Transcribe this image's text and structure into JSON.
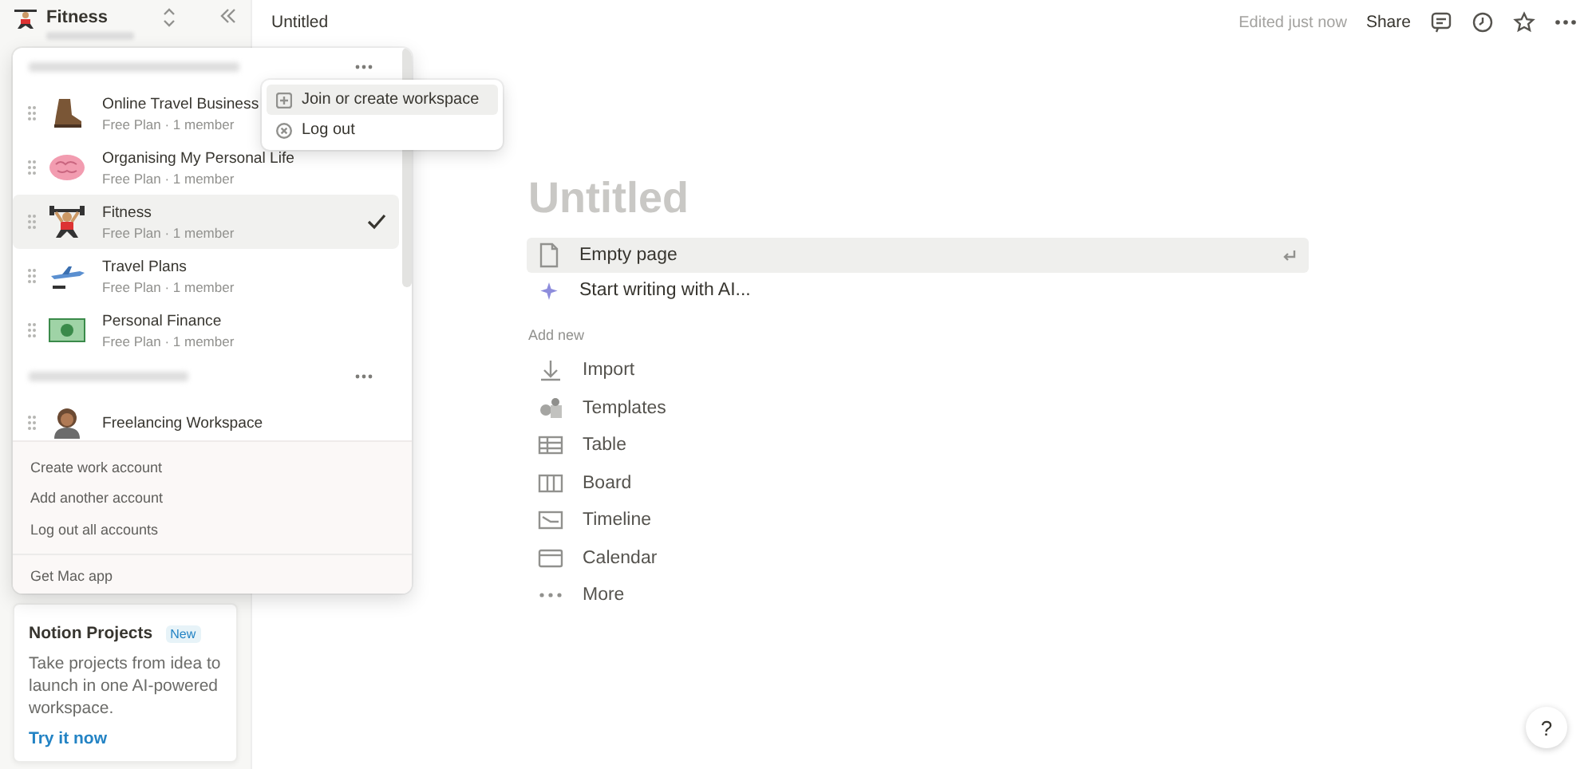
{
  "sidebar": {
    "workspace": "Fitness",
    "card": {
      "title": "Notion Projects",
      "badge": "New",
      "text": "Take projects from idea to launch in one AI-powered workspace.",
      "link": "Try it now"
    }
  },
  "switcher": {
    "groups": [
      {
        "workspaces": [
          {
            "name": "Online Travel Business",
            "plan": "Free Plan · 1 member",
            "selected": false
          },
          {
            "name": "Organising My Personal Life",
            "plan": "Free Plan · 1 member",
            "selected": false
          },
          {
            "name": "Fitness",
            "plan": "Free Plan · 1 member",
            "selected": true
          },
          {
            "name": "Travel Plans",
            "plan": "Free Plan · 1 member",
            "selected": false
          },
          {
            "name": "Personal Finance",
            "plan": "Free Plan · 1 member",
            "selected": false
          }
        ]
      },
      {
        "workspaces": [
          {
            "name": "Freelancing Workspace",
            "selected": false
          }
        ]
      }
    ],
    "footer": [
      "Create work account",
      "Add another account",
      "Log out all accounts"
    ],
    "app_link": "Get Mac app",
    "submenu": [
      {
        "label": "Join or create workspace",
        "selected": true
      },
      {
        "label": "Log out",
        "selected": false
      }
    ]
  },
  "topbar": {
    "title": "Untitled",
    "status": "Edited just now",
    "share": "Share"
  },
  "page": {
    "title_placeholder": "Untitled",
    "actions": [
      {
        "label": "Empty page",
        "selected": true
      },
      {
        "label": "Start writing with AI...",
        "selected": false
      }
    ],
    "add_new_heading": "Add new",
    "add_new": [
      "Import",
      "Templates",
      "Table",
      "Board",
      "Timeline",
      "Calendar",
      "More"
    ]
  },
  "help": "?"
}
